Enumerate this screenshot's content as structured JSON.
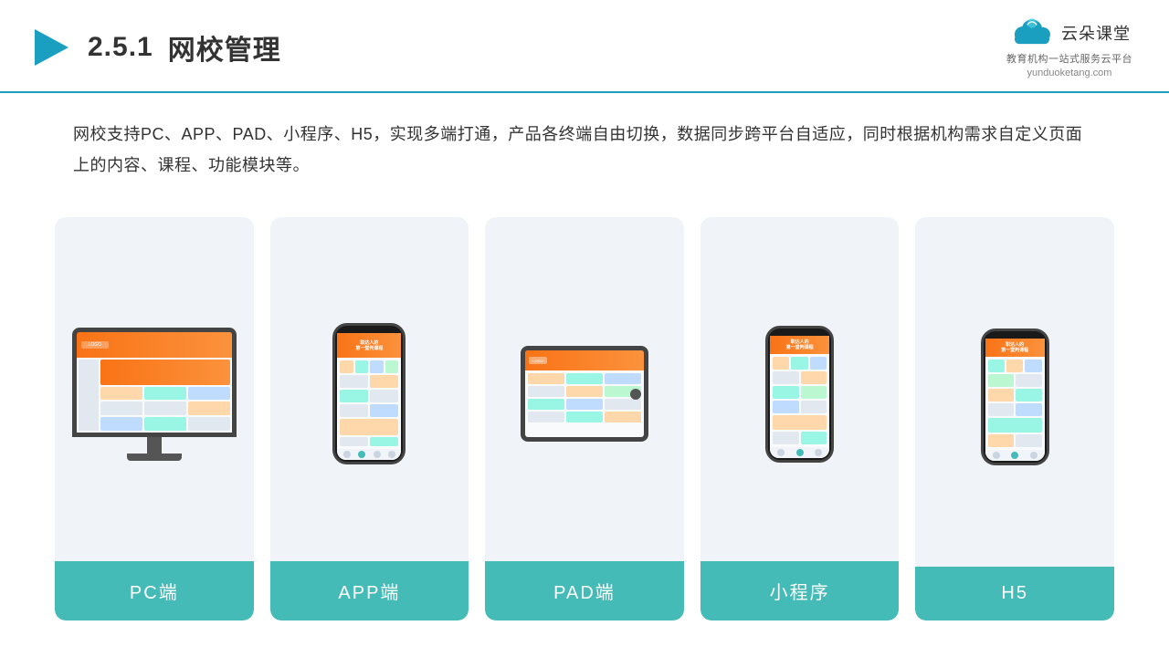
{
  "header": {
    "section_number": "2.5.1",
    "title": "网校管理",
    "brand": {
      "name": "云朵课堂",
      "tagline": "教育机构一站式服务云平台",
      "url": "yunduoketang.com"
    }
  },
  "description": {
    "text": "网校支持PC、APP、PAD、小程序、H5，实现多端打通，产品各终端自由切换，数据同步跨平台自适应，同时根据机构需求自定义页面上的内容、课程、功能模块等。"
  },
  "cards": [
    {
      "id": "pc",
      "label": "PC端"
    },
    {
      "id": "app",
      "label": "APP端"
    },
    {
      "id": "pad",
      "label": "PAD端"
    },
    {
      "id": "miniprogram",
      "label": "小程序"
    },
    {
      "id": "h5",
      "label": "H5"
    }
  ],
  "colors": {
    "accent": "#45bbb8",
    "header_border": "#1a9fc0",
    "arrow_blue": "#1a9fc0",
    "card_bg": "#f0f4f8"
  }
}
